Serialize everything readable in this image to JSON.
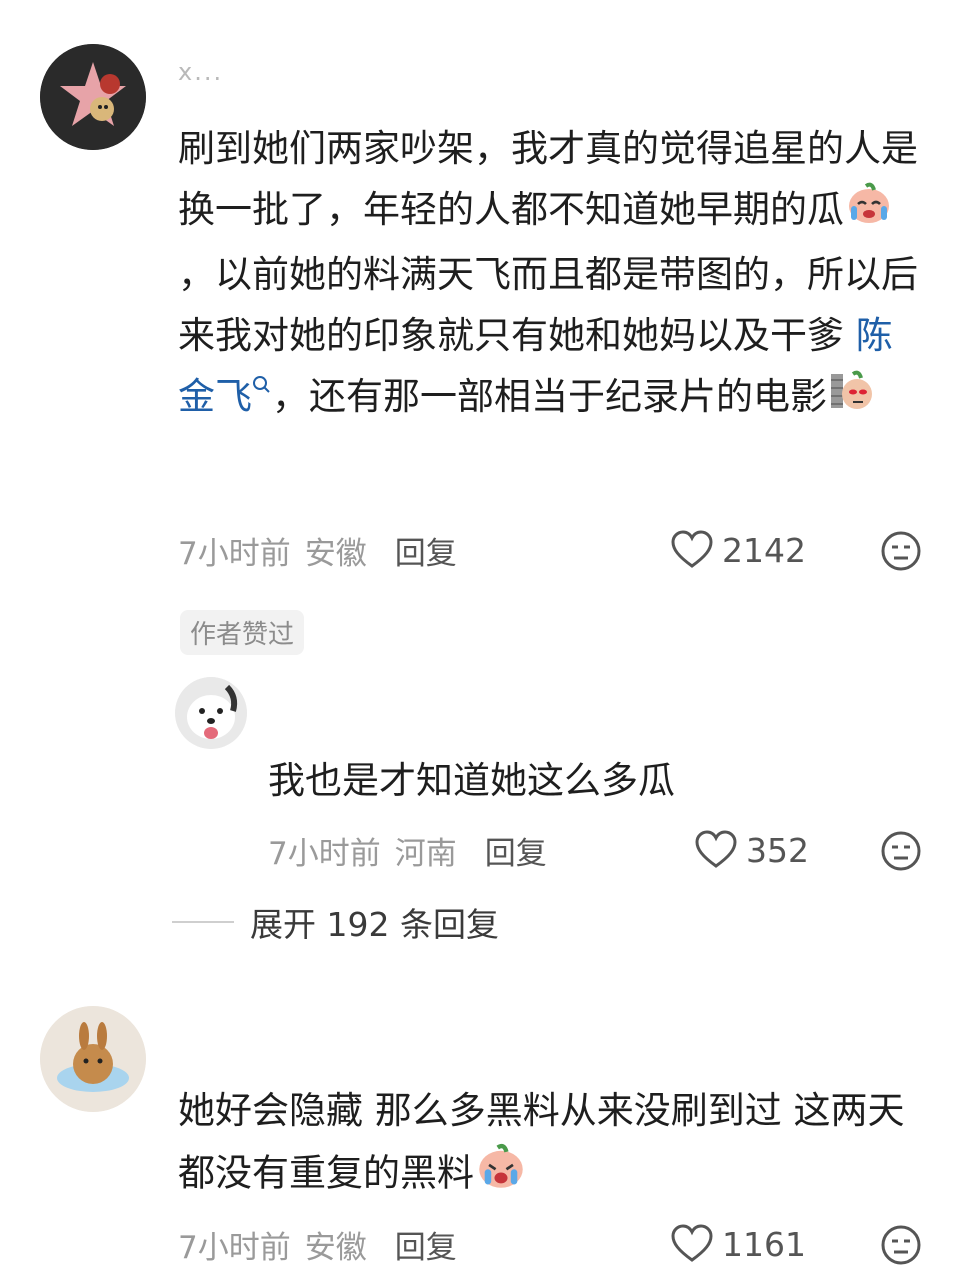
{
  "comments": [
    {
      "username": "x...",
      "text_before_mention": "刷到她们两家吵架，我才真的觉得追星的人是换一批了，年轻的人都不知道她早期的瓜",
      "text_after_emoji1": "，以前她的料满天飞而且都是带图的，所以后来我对她的印象就只有她和她妈以及干爹",
      "mention": "陈金飞",
      "text_after_mention": "，还有那一部相当于纪录片的电影",
      "time": "7小时前",
      "location": "安徽",
      "reply_label": "回复",
      "likes": "2142",
      "badge": "作者赞过"
    },
    {
      "username": "",
      "text": "我也是才知道她这么多瓜",
      "time": "7小时前",
      "location": "河南",
      "reply_label": "回复",
      "likes": "352"
    },
    {
      "username": "",
      "text": "她好会隐藏 那么多黑料从来没刷到过 这两天都没有重复的黑料",
      "time": "7小时前",
      "location": "安徽",
      "reply_label": "回复",
      "likes": "1161"
    }
  ],
  "expand_replies": "展开 192 条回复",
  "icons": [
    "heart-icon",
    "dislike-face-icon",
    "search-icon",
    "crying-emoji",
    "peeking-emoji"
  ]
}
